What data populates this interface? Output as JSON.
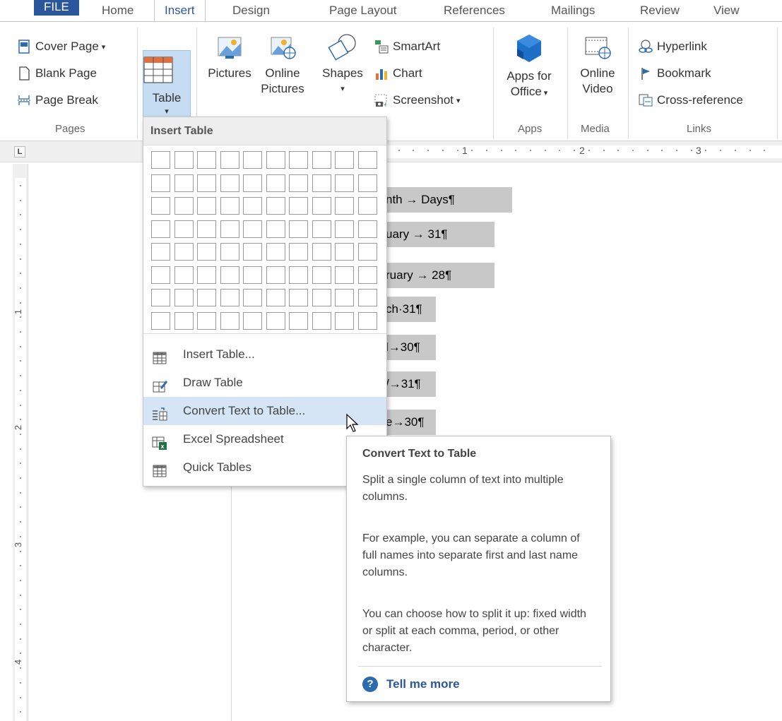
{
  "ribbon": {
    "tabs": [
      "FILE",
      "Home",
      "Insert",
      "Design",
      "Page Layout",
      "References",
      "Mailings",
      "Review",
      "View"
    ],
    "active_tab": "Insert",
    "groups": {
      "pages": {
        "label": "Pages",
        "cover_page": "Cover Page",
        "blank_page": "Blank Page",
        "page_break": "Page Break"
      },
      "tables": {
        "table_label": "Table"
      },
      "illustrations": {
        "pictures": "Pictures",
        "online_pictures_1": "Online",
        "online_pictures_2": "Pictures",
        "shapes": "Shapes",
        "smartart": "SmartArt",
        "chart": "Chart",
        "screenshot": "Screenshot"
      },
      "apps": {
        "label": "Apps",
        "apps_for_office_1": "Apps for",
        "apps_for_office_2": "Office"
      },
      "media": {
        "label": "Media",
        "online_video_1": "Online",
        "online_video_2": "Video"
      },
      "links": {
        "label": "Links",
        "hyperlink": "Hyperlink",
        "bookmark": "Bookmark",
        "cross_reference": "Cross-reference"
      }
    }
  },
  "ruler": {
    "tab_selector": "L",
    "h_numbers": [
      "1",
      "2",
      "3"
    ],
    "v_numbers": [
      "1",
      "2",
      "3",
      "4"
    ]
  },
  "document": {
    "lines": [
      "nth  →   Days¶",
      "uary  →   31¶",
      "ruary  →   28¶",
      "ch·31¶",
      "l→30¶",
      "/→31¶",
      "e→30¶"
    ]
  },
  "dropdown": {
    "header": "Insert Table",
    "grid": {
      "columns": 10,
      "rows": 8
    },
    "items": [
      {
        "label": "Insert Table...",
        "icon": "table-grid-icon"
      },
      {
        "label": "Draw Table",
        "icon": "draw-table-icon"
      },
      {
        "label": "Convert Text to Table...",
        "icon": "convert-text-icon",
        "hovered": true
      },
      {
        "label": "Excel Spreadsheet",
        "icon": "excel-icon"
      },
      {
        "label": "Quick Tables",
        "icon": "quick-tables-icon"
      }
    ]
  },
  "tooltip": {
    "title": "Convert Text to Table",
    "p1": "Split a single column of text into multiple columns.",
    "p2": "For example, you can separate a column of full names into separate first and last name columns.",
    "p3": "You can choose how to split it up: fixed width or split at each comma, period, or other character.",
    "more": "Tell me more"
  },
  "colors": {
    "accent": "#2b579a",
    "highlight": "#c5dcf3",
    "menu_hover": "#d5e5f5",
    "selection": "#c8c8c8"
  }
}
